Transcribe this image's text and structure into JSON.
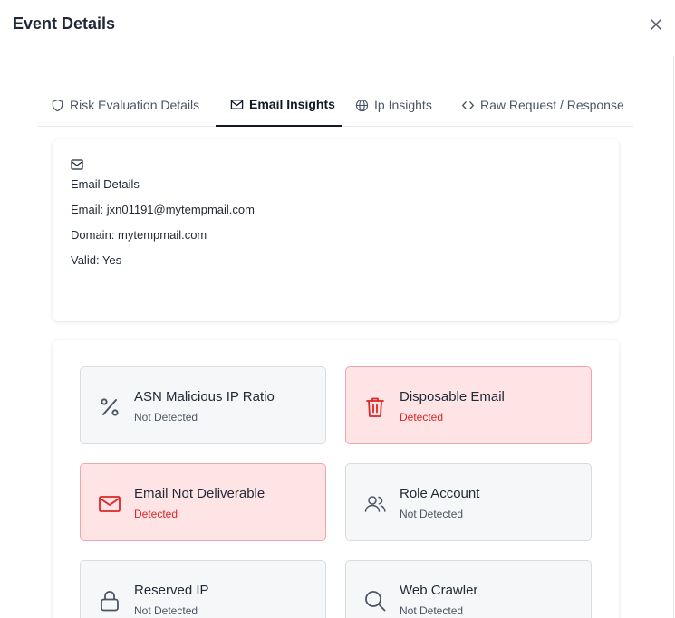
{
  "dialog": {
    "title": "Event Details"
  },
  "tabs": [
    {
      "label": "Risk Evaluation Details",
      "icon": "shield-icon",
      "active": false
    },
    {
      "label": "Email Insights",
      "icon": "mail-icon",
      "active": true
    },
    {
      "label": "Ip Insights",
      "icon": "globe-icon",
      "active": false
    },
    {
      "label": "Raw Request / Response",
      "icon": "code-icon",
      "active": false
    }
  ],
  "email_details": {
    "icon": "mail-icon",
    "heading": "Email Details",
    "email": "Email: jxn01191@mytempmail.com",
    "domain": "Domain: mytempmail.com",
    "valid": "Valid: Yes"
  },
  "insights": [
    {
      "name": "ASN Malicious IP Ratio",
      "status": "Not Detected",
      "icon": "percent-icon"
    },
    {
      "name": "Disposable Email",
      "status": "Detected",
      "icon": "trash-icon"
    },
    {
      "name": "Email Not Deliverable",
      "status": "Detected",
      "icon": "mail-icon"
    },
    {
      "name": "Role Account",
      "status": "Not Detected",
      "icon": "users-icon"
    },
    {
      "name": "Reserved IP",
      "status": "Not Detected",
      "icon": "lock-icon"
    },
    {
      "name": "Web Crawler",
      "status": "Not Detected",
      "icon": "search-icon"
    }
  ],
  "colors": {
    "alert_bg": "#ffe4e6",
    "alert_border": "#f2a5ad",
    "alert_text": "#dc2626",
    "neutral_bg": "#f6f7f9",
    "active_tab": "#111827"
  }
}
